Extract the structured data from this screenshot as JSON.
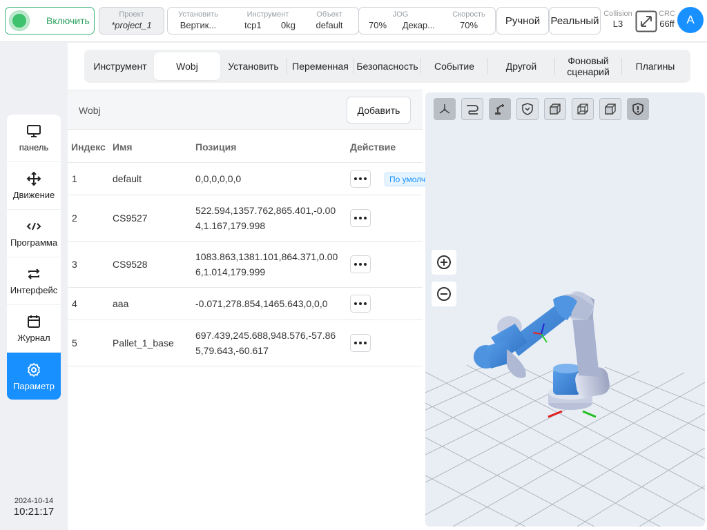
{
  "topbar": {
    "power_label": "Включить",
    "project": {
      "label": "Проект",
      "value": "*project_1"
    },
    "install": {
      "label": "Установить",
      "value": "Вертик..."
    },
    "tool": {
      "label": "Инструмент",
      "tcp": "tcp1",
      "payload": "0kg"
    },
    "object": {
      "label": "Объект",
      "value": "default"
    },
    "jog": {
      "label": "JOG",
      "percent": "70%",
      "frame": "Декар..."
    },
    "speed": {
      "label": "Скорость",
      "value": "70%"
    },
    "mode_button": "Ручной",
    "env_button": "Реальный",
    "collision": {
      "label": "Collision",
      "value": "L3"
    },
    "crc": {
      "label": "CRC",
      "value": "66ff"
    },
    "avatar_letter": "A"
  },
  "leftnav": {
    "items": [
      {
        "label": "панель",
        "icon": "monitor-icon"
      },
      {
        "label": "Движение",
        "icon": "move-arrows-icon"
      },
      {
        "label": "Программа",
        "icon": "code-icon"
      },
      {
        "label": "Интерфейс",
        "icon": "swap-arrows-icon"
      },
      {
        "label": "Журнал",
        "icon": "calendar-icon"
      },
      {
        "label": "Параметр",
        "icon": "gear-icon",
        "active": true
      }
    ]
  },
  "clock": {
    "date": "2024-10-14",
    "time": "10:21:17"
  },
  "tabs": [
    {
      "label": "Инструмент"
    },
    {
      "label": "Wobj",
      "active": true
    },
    {
      "label": "Установить"
    },
    {
      "label": "Переменная"
    },
    {
      "label": "Безопасность"
    },
    {
      "label": "Событие"
    },
    {
      "label": "Другой"
    },
    {
      "label": "Фоновый сценарий"
    },
    {
      "label": "Плагины"
    }
  ],
  "wobj": {
    "title": "Wobj",
    "add_button": "Добавить",
    "columns": {
      "index": "Индекс",
      "name": "Имя",
      "position": "Позиция",
      "action": "Действие"
    },
    "default_tag": "По умолч",
    "rows": [
      {
        "index": "1",
        "name": "default",
        "position": "0,0,0,0,0,0"
      },
      {
        "index": "2",
        "name": "CS9527",
        "position": "522.594,1357.762,865.401,-0.004,1.167,179.998"
      },
      {
        "index": "3",
        "name": "CS9528",
        "position": "1083.863,1381.101,864.371,0.006,1.014,179.999"
      },
      {
        "index": "4",
        "name": "aaa",
        "position": "-0.071,278.854,1465.643,0,0,0"
      },
      {
        "index": "5",
        "name": "Pallet_1_base",
        "position": "697.439,245.688,948.576,-57.865,79.643,-60.617"
      }
    ]
  },
  "viewport": {
    "toolbar_icons": [
      "axes-view-icon",
      "path-icon",
      "robot-arm-icon",
      "shield-check-icon",
      "cube-solid-icon",
      "cube-wire-icon",
      "cube-front-icon",
      "shield-alert-icon"
    ],
    "zoom_in_icon": "zoom-in-icon",
    "zoom_out_icon": "zoom-out-icon"
  },
  "colors": {
    "accent": "#1890ff",
    "power": "#3ec26d",
    "robot": "#3d86d8",
    "joint": "#b7bfd6"
  }
}
